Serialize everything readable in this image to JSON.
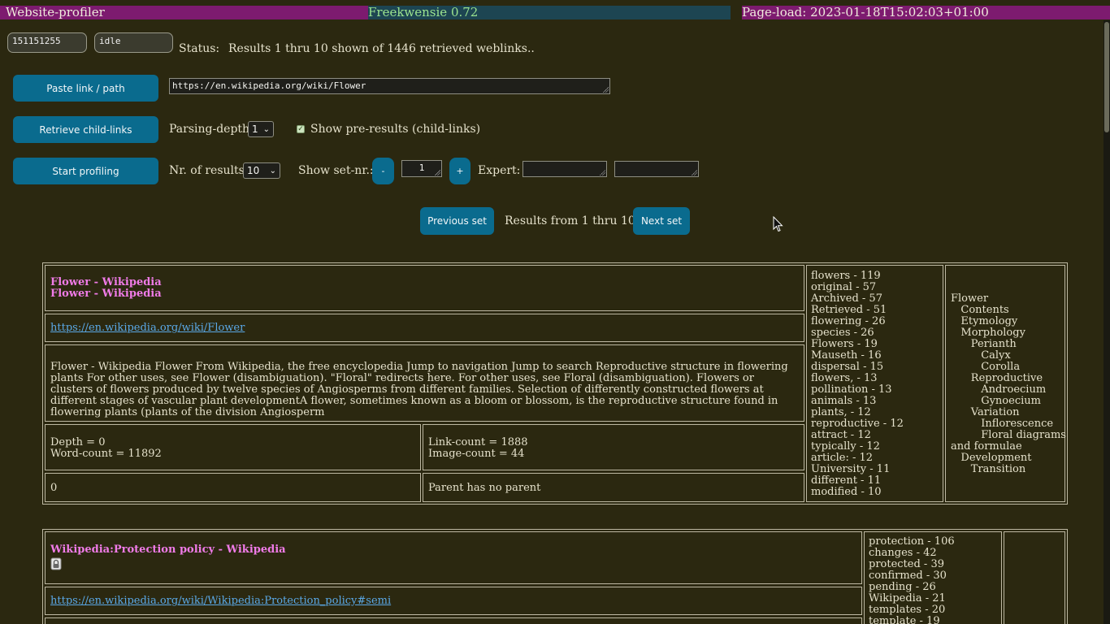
{
  "topbar": {
    "app_name": "Website-profiler",
    "version": "Freekwensie 0.72",
    "page_load": "Page-load: 2023-01-18T15:02:03+01:00"
  },
  "status_row": {
    "id_value": "151151255",
    "state_value": "idle",
    "status_label": "Status:",
    "status_text": "Results 1 thru 10 shown of 1446 retrieved weblinks.."
  },
  "controls": {
    "paste_button": "Paste link / path",
    "link_input_value": "https://en.wikipedia.org/wiki/Flower",
    "retrieve_button": "Retrieve child-links",
    "parsing_depth_label": "Parsing-depth:",
    "parsing_depth_value": "1",
    "show_pre_results_label": "Show pre-results (child-links)",
    "start_button": "Start profiling",
    "nr_results_label": "Nr. of results:",
    "nr_results_value": "10",
    "show_set_label": "Show set-nr.:",
    "minus_button": "-",
    "set_nr_value": "1",
    "plus_button": "+",
    "expert_label": "Expert:",
    "expert_value_1": "",
    "expert_value_2": ""
  },
  "pager": {
    "prev_button": "Previous set",
    "range_text": "Results from 1 thru 10",
    "next_button": "Next set"
  },
  "results": [
    {
      "title_1": "Flower - Wikipedia",
      "title_2": "Flower - Wikipedia",
      "url": "https://en.wikipedia.org/wiki/Flower",
      "snippet": "Flower - Wikipedia Flower From Wikipedia, the free encyclopedia Jump to navigation Jump to search Reproductive structure in flowering plants For other uses, see Flower (disambiguation). \"Floral\" redirects here. For other uses, see Floral (disambiguation). Flowers or clusters of flowers produced by twelve species of Angiosperms from different families. Selection of differently constructed flowers at different stages of vascular plant developmentA flower, sometimes known as a bloom or blossom, is the reproductive structure found in flowering plants (plants of the division Angiosperm",
      "depth": "Depth = 0",
      "word_count": "Word-count = 11892",
      "link_count": "Link-count = 1888",
      "image_count": "Image-count = 44",
      "parent_id": "0",
      "parent_text": "Parent has no parent",
      "keywords": [
        "flowers - 119",
        "original - 57",
        "Archived - 57",
        "Retrieved - 51",
        "flowering - 26",
        "species - 26",
        "Flowers - 19",
        "Mauseth - 16",
        "dispersal - 15",
        "flowers, - 13",
        "pollination - 13",
        "animals - 13",
        "plants, - 12",
        "reproductive - 12",
        "attract - 12",
        "typically - 12",
        "article: - 12",
        "University - 11",
        "different - 11",
        "modified - 10"
      ],
      "toc": [
        "Flower",
        "   Contents",
        "   Etymology",
        "   Morphology",
        "      Perianth",
        "         Calyx",
        "         Corolla",
        "      Reproductive",
        "         Androecium",
        "         Gynoecium",
        "      Variation",
        "         Inflorescence",
        "         Floral diagrams",
        "and formulae",
        "   Development",
        "      Transition"
      ]
    },
    {
      "title_1": "Wikipedia:Protection policy - Wikipedia",
      "url": "https://en.wikipedia.org/wiki/Wikipedia:Protection_policy#semi",
      "keywords": [
        "protection - 106",
        "changes - 42",
        "protected - 39",
        "confirmed - 30",
        "pending - 26",
        "Wikipedia - 21",
        "templates - 20",
        "template - 19"
      ]
    }
  ]
}
